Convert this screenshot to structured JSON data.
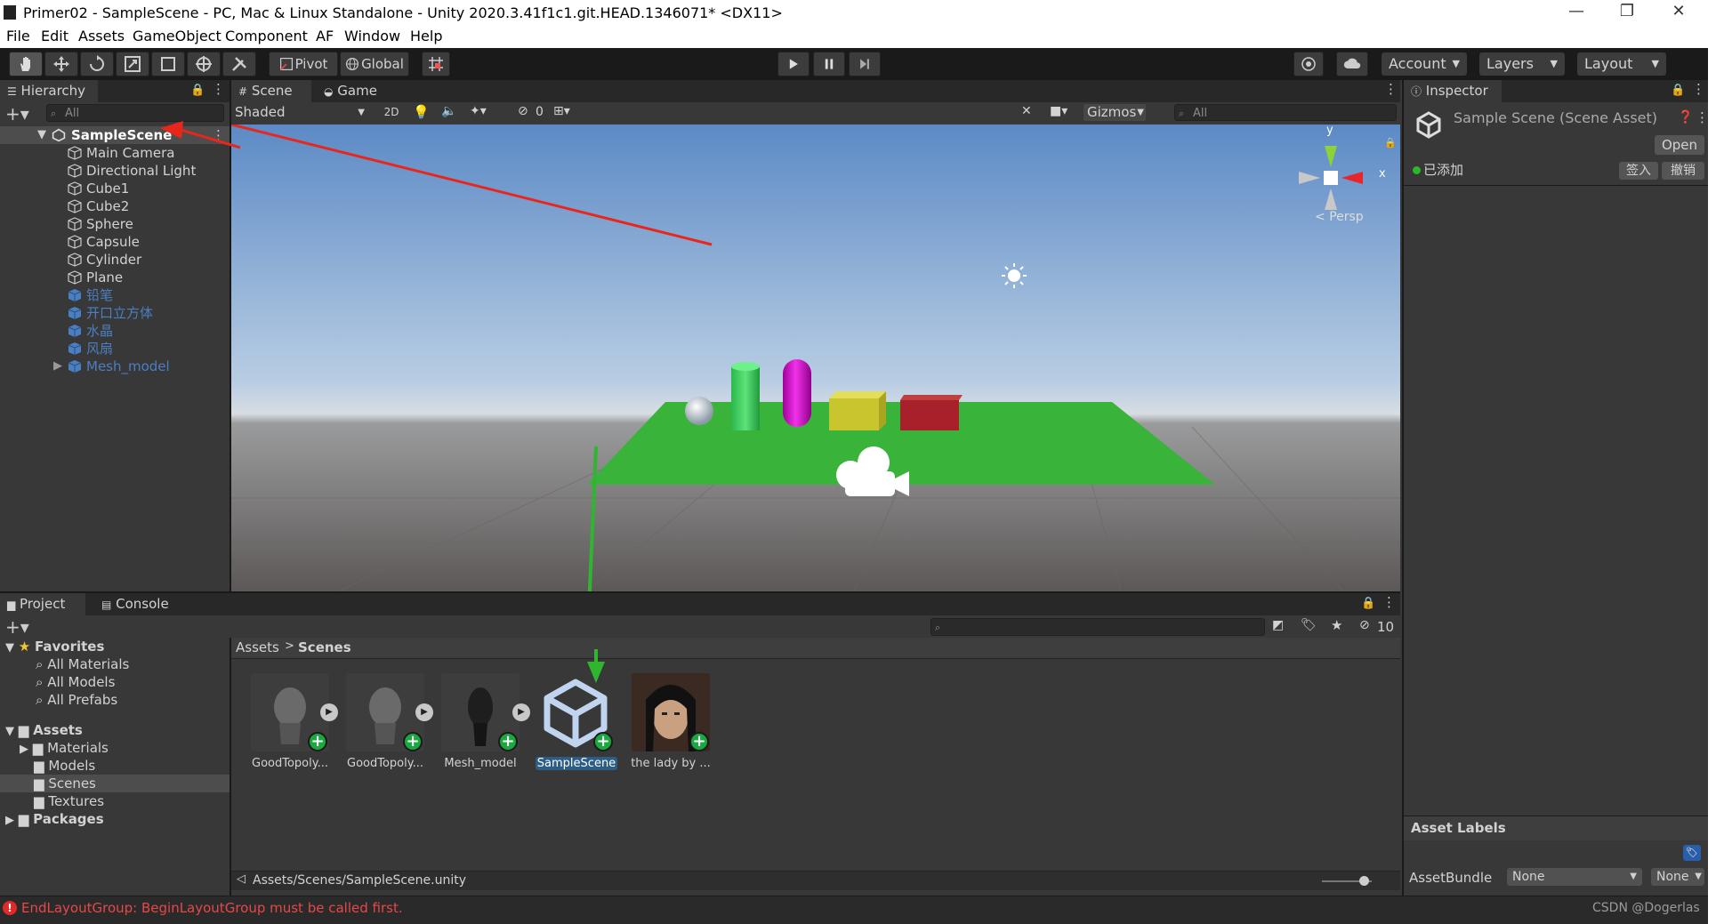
{
  "window": {
    "title": "Primer02 - SampleScene - PC, Mac & Linux Standalone - Unity 2020.3.41f1c1.git.HEAD.1346071* <DX11>",
    "minimize": "—",
    "maximize": "❐",
    "close": "✕"
  },
  "menu": [
    "File",
    "Edit",
    "Assets",
    "GameObject",
    "Component",
    "AF",
    "Window",
    "Help"
  ],
  "toolbar": {
    "pivot": "Pivot",
    "global": "Global",
    "account": "Account",
    "layers": "Layers",
    "layout": "Layout"
  },
  "hierarchy": {
    "tab": "Hierarchy",
    "search_placeholder": "All",
    "scene": "SampleScene",
    "items": [
      "Main Camera",
      "Directional Light",
      "Cube1",
      "Cube2",
      "Sphere",
      "Capsule",
      "Cylinder",
      "Plane"
    ],
    "prefab_items": [
      "铅笔",
      "开口立方体",
      "水晶",
      "风扇",
      "Mesh_model"
    ]
  },
  "scene_view": {
    "tab_scene": "Scene",
    "tab_game": "Game",
    "shading": "Shaded",
    "mode_2d": "2D",
    "hidden_count": "0",
    "gizmos": "Gizmos",
    "search_placeholder": "All",
    "axis_y": "y",
    "axis_x": "x",
    "persp": "Persp"
  },
  "inspector": {
    "tab": "Inspector",
    "title": "Sample Scene (Scene Asset)",
    "open": "Open",
    "status": "已添加",
    "checkin": "签入",
    "revert": "撤销",
    "asset_labels": "Asset Labels",
    "asset_bundle_label": "AssetBundle",
    "asset_bundle_value": "None",
    "asset_bundle_variant": "None"
  },
  "project": {
    "tab_project": "Project",
    "tab_console": "Console",
    "hidden_count": "10",
    "favorites": "Favorites",
    "favorite_items": [
      "All Materials",
      "All Models",
      "All Prefabs"
    ],
    "assets": "Assets",
    "asset_folders": [
      "Materials",
      "Models",
      "Scenes",
      "Textures"
    ],
    "packages": "Packages",
    "breadcrumb_root": "Assets",
    "breadcrumb_current": "Scenes",
    "files": [
      "GoodTopoly...",
      "GoodTopoly...",
      "Mesh_model",
      "SampleScene",
      "the lady by ..."
    ],
    "path": "Assets/Scenes/SampleScene.unity"
  },
  "status_bar": {
    "error": "EndLayoutGroup: BeginLayoutGroup must be called first.",
    "watermark": "CSDN @Dogerlas"
  },
  "colors": {
    "accent_selected": "#2c5d87",
    "annotation_red": "#e8261b",
    "annotation_green": "#2fb52f",
    "plane_green": "#3ab33a"
  }
}
